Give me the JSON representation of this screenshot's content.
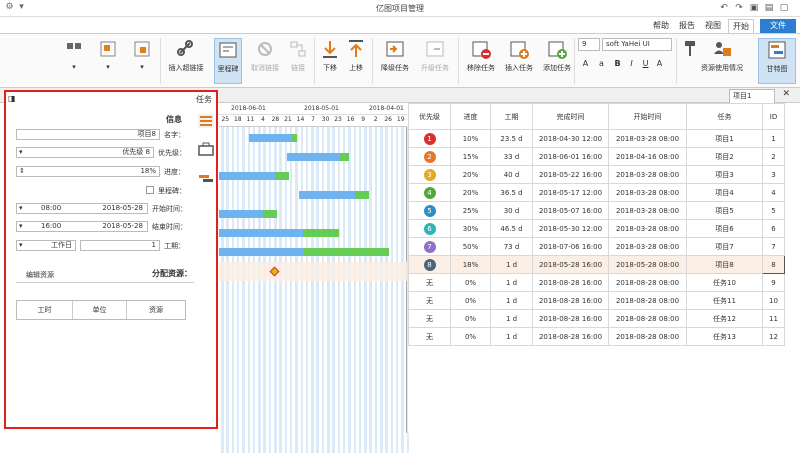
{
  "title": "亿图项目管理",
  "menu": {
    "file": "文件",
    "start": "开始",
    "view": "视图",
    "report": "报告",
    "help": "帮助"
  },
  "ribbon": {
    "buttons": [
      {
        "label": "甘特图",
        "icon": "gantt-view-icon"
      },
      {
        "label": "资源使用情况",
        "icon": "resource-usage-icon"
      },
      {
        "label": "添加任务",
        "icon": "add-task-icon"
      },
      {
        "label": "插入任务",
        "icon": "insert-task-icon"
      },
      {
        "label": "移除任务",
        "icon": "remove-task-icon"
      },
      {
        "label": "升级任务",
        "icon": "upgrade-task-icon"
      },
      {
        "label": "降级任务",
        "icon": "downgrade-task-icon"
      },
      {
        "label": "上移",
        "icon": "move-up-icon"
      },
      {
        "label": "下移",
        "icon": "move-down-icon"
      },
      {
        "label": "链接",
        "icon": "link-icon"
      },
      {
        "label": "取消链接",
        "icon": "unlink-icon"
      },
      {
        "label": "里程碑",
        "icon": "milestone-icon"
      },
      {
        "label": "插入超链接",
        "icon": "hyperlink-icon"
      }
    ],
    "font_name": "soft YaHei UI",
    "font_size": "9"
  },
  "doc_tab": "项目1",
  "left_panel": {
    "header": "任务",
    "section_info": "信息",
    "name_label": "名字：",
    "name_value": "项目8",
    "priority_label": "优先级：",
    "priority_value": "优先级 8",
    "progress_label": "进度：",
    "progress_value": "18%",
    "milestone_label": "里程碑：",
    "start_label": "开始时间：",
    "start_date": "2018-05-28",
    "start_time": "08:00",
    "finish_label": "结束时间：",
    "finish_date": "2018-05-28",
    "finish_time": "16:00",
    "duration_label": "工期：",
    "duration_value": "1",
    "duration_unit": "工作日",
    "resource_label": "分配资源：",
    "edit_resource": "编辑资源",
    "res_cols": [
      "资源",
      "单位",
      "工时"
    ]
  },
  "gantt": {
    "months": [
      "2018-04-01",
      "2018-05-01",
      "2018-06-01"
    ],
    "days": [
      "19",
      "26",
      "2",
      "9",
      "16",
      "23",
      "30",
      "7",
      "14",
      "21",
      "28",
      "4",
      "11",
      "18",
      "25"
    ]
  },
  "table": {
    "columns": [
      "ID",
      "任务",
      "开始时间",
      "完成时间",
      "工期",
      "进度",
      "优先级"
    ],
    "rows": [
      {
        "id": "1",
        "task": "项目1",
        "start": "2018-03-28 08:00",
        "finish": "2018-04-30 12:00",
        "dur": "23.5 d",
        "prog": "10%",
        "prio": "1",
        "color": "#d9302b"
      },
      {
        "id": "2",
        "task": "项目2",
        "start": "2018-04-16 08:00",
        "finish": "2018-06-01 16:00",
        "dur": "33 d",
        "prog": "15%",
        "prio": "2",
        "color": "#e8762a"
      },
      {
        "id": "3",
        "task": "项目3",
        "start": "2018-03-28 08:00",
        "finish": "2018-05-22 16:00",
        "dur": "40 d",
        "prog": "20%",
        "prio": "3",
        "color": "#e6a81e"
      },
      {
        "id": "4",
        "task": "项目4",
        "start": "2018-03-28 08:00",
        "finish": "2018-05-17 12:00",
        "dur": "36.5 d",
        "prog": "20%",
        "prio": "4",
        "color": "#53a83c"
      },
      {
        "id": "5",
        "task": "项目5",
        "start": "2018-03-28 08:00",
        "finish": "2018-05-07 16:00",
        "dur": "30 d",
        "prog": "25%",
        "prio": "5",
        "color": "#2d8fc8"
      },
      {
        "id": "6",
        "task": "项目6",
        "start": "2018-03-28 08:00",
        "finish": "2018-05-30 12:00",
        "dur": "46.5 d",
        "prog": "30%",
        "prio": "6",
        "color": "#2fb3b6"
      },
      {
        "id": "7",
        "task": "项目7",
        "start": "2018-03-28 08:00",
        "finish": "2018-07-06 16:00",
        "dur": "73 d",
        "prog": "50%",
        "prio": "7",
        "color": "#8f6fc8"
      },
      {
        "id": "8",
        "task": "项目8",
        "start": "2018-05-28 08:00",
        "finish": "2018-05-28 16:00",
        "dur": "1 d",
        "prog": "18%",
        "prio": "8",
        "color": "#4e6577"
      },
      {
        "id": "9",
        "task": "任务10",
        "start": "2018-08-28 08:00",
        "finish": "2018-08-28 16:00",
        "dur": "1 d",
        "prog": "0%",
        "prio": "无",
        "color": ""
      },
      {
        "id": "10",
        "task": "任务11",
        "start": "2018-08-28 08:00",
        "finish": "2018-08-28 16:00",
        "dur": "1 d",
        "prog": "0%",
        "prio": "无",
        "color": ""
      },
      {
        "id": "11",
        "task": "任务12",
        "start": "2018-08-28 08:00",
        "finish": "2018-08-28 16:00",
        "dur": "1 d",
        "prog": "0%",
        "prio": "无",
        "color": ""
      },
      {
        "id": "12",
        "task": "任务13",
        "start": "2018-08-28 08:00",
        "finish": "2018-08-28 16:00",
        "dur": "1 d",
        "prog": "0%",
        "prio": "无",
        "color": ""
      }
    ]
  },
  "colors": {
    "accent_red": "#e0201b",
    "file_tab": "#2c7fd0",
    "bar_blue": "#6fb2f0",
    "bar_green": "#66cc55"
  }
}
